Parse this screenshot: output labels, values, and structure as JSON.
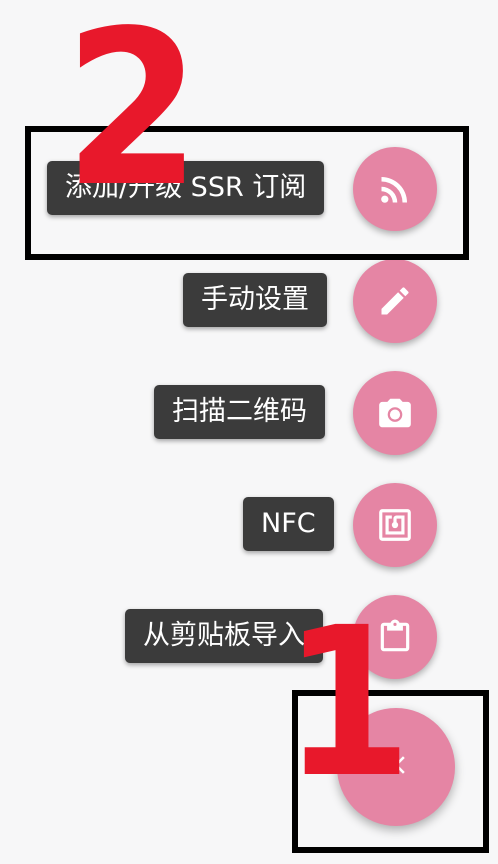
{
  "menu": {
    "items": [
      {
        "label": "添加/升级 SSR 订阅",
        "icon": "rss-icon"
      },
      {
        "label": "手动设置",
        "icon": "pencil-icon"
      },
      {
        "label": "扫描二维码",
        "icon": "camera-icon"
      },
      {
        "label": "NFC",
        "icon": "nfc-icon"
      },
      {
        "label": "从剪贴板导入",
        "icon": "clipboard-icon"
      }
    ],
    "close_icon": "close-icon"
  },
  "annotations": {
    "step_one": "1",
    "step_two": "2"
  },
  "colors": {
    "fab": "#e585a4",
    "label_bg": "#3b3b3b",
    "annotation_red": "#e8182b",
    "background": "#f7f7f8"
  }
}
